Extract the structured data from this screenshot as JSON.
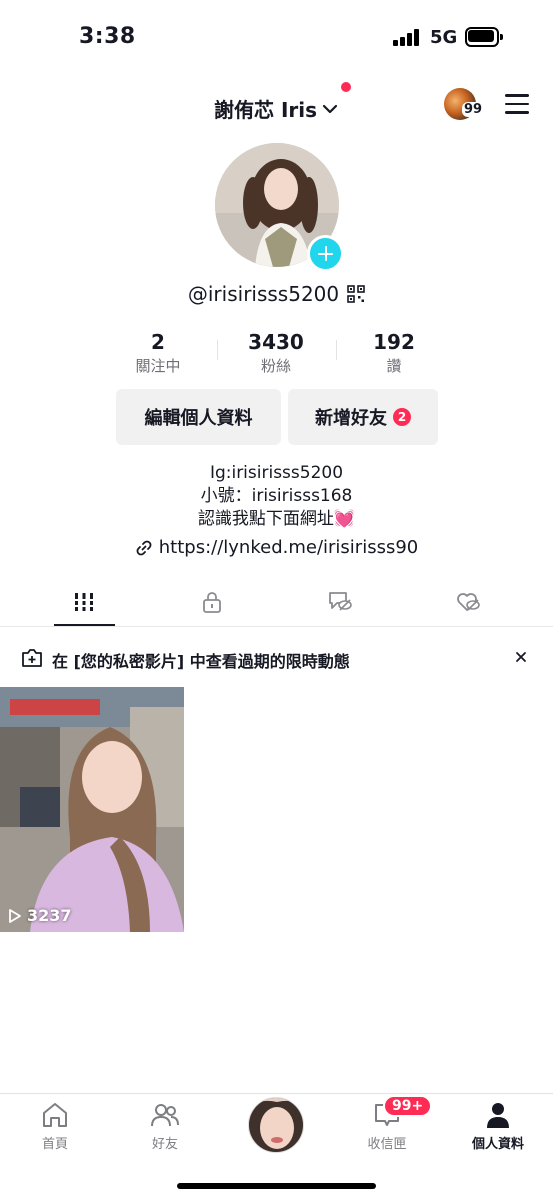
{
  "status_bar": {
    "time": "3:38",
    "network": "5G"
  },
  "header": {
    "display_name": "謝侑芯 Iris",
    "friends_badge": "99"
  },
  "profile": {
    "handle": "@irisirisss5200"
  },
  "stats": [
    {
      "value": "2",
      "label": "關注中"
    },
    {
      "value": "3430",
      "label": "粉絲"
    },
    {
      "value": "192",
      "label": "讚"
    }
  ],
  "buttons": {
    "edit_profile": "編輯個人資料",
    "add_friends": "新增好友",
    "add_friends_badge": "2"
  },
  "bio": {
    "line1": "Ig:irisirisss5200",
    "line2": "小號：irisirisss168",
    "line3": "認識我點下面網址",
    "line3_emoji": "💓",
    "link": "https://lynked.me/irisirisss90"
  },
  "notice": {
    "text": "在 [您的私密影片] 中查看過期的限時動態"
  },
  "videos": [
    {
      "play_count": "3237"
    }
  ],
  "bottom_nav": {
    "items": [
      {
        "label": "首頁",
        "icon": "home-icon"
      },
      {
        "label": "好友",
        "icon": "friends-icon"
      },
      {
        "label": "收信匣",
        "icon": "inbox-icon",
        "badge": "99+"
      },
      {
        "label": "個人資料",
        "icon": "profile-icon"
      }
    ]
  },
  "colors": {
    "accent": "#fe2c55",
    "plus": "#20d5ec",
    "text": "#161823",
    "muted": "#6f7077",
    "button_bg": "#f1f1f2"
  }
}
